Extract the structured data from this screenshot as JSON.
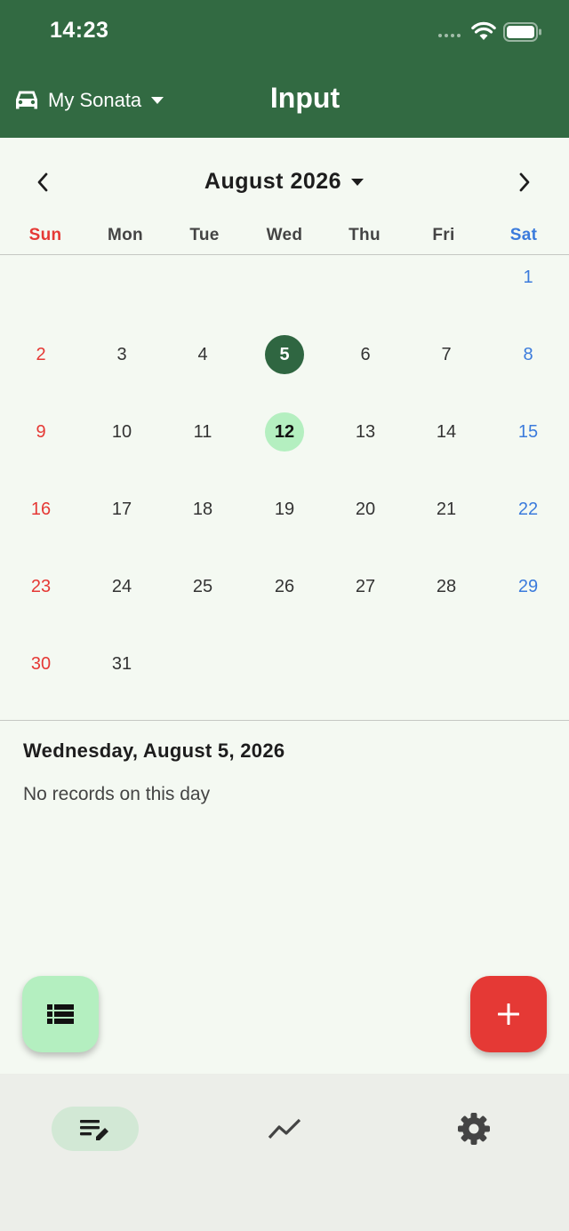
{
  "status_bar": {
    "time": "14:23"
  },
  "app_bar": {
    "car_name": "My Sonata",
    "title": "Input"
  },
  "calendar": {
    "month_label": "August 2026",
    "weekdays": [
      "Sun",
      "Mon",
      "Tue",
      "Wed",
      "Thu",
      "Fri",
      "Sat"
    ],
    "weeks": [
      [
        "",
        "",
        "",
        "",
        "",
        "",
        "1"
      ],
      [
        "2",
        "3",
        "4",
        "5",
        "6",
        "7",
        "8"
      ],
      [
        "9",
        "10",
        "11",
        "12",
        "13",
        "14",
        "15"
      ],
      [
        "16",
        "17",
        "18",
        "19",
        "20",
        "21",
        "22"
      ],
      [
        "23",
        "24",
        "25",
        "26",
        "27",
        "28",
        "29"
      ],
      [
        "30",
        "31",
        "",
        "",
        "",
        "",
        ""
      ]
    ],
    "selected_day": "5",
    "today_day": "12"
  },
  "details": {
    "selected_date": "Wednesday, August 5, 2026",
    "empty_message": "No records on this day"
  },
  "colors": {
    "primary": "#326a42",
    "accent_red": "#e53935",
    "saturday_blue": "#3b7bdc",
    "today_green": "#b4efc0",
    "background": "#f4f9f2"
  },
  "bottom_nav": {
    "items": [
      {
        "icon": "edit-note-icon",
        "active": true
      },
      {
        "icon": "trending-line-icon",
        "active": false
      },
      {
        "icon": "gear-icon",
        "active": false
      }
    ]
  }
}
